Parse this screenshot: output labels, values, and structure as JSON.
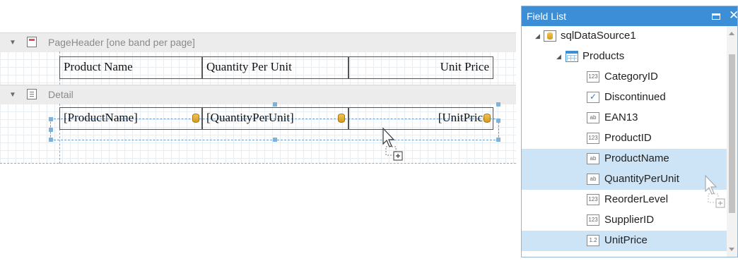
{
  "designer": {
    "page_header": {
      "title": "PageHeader [one band per page]"
    },
    "header_cells": {
      "product_name": "Product Name",
      "quantity_per_unit": "Quantity Per Unit",
      "unit_price": "Unit Price"
    },
    "detail": {
      "title": "Detail"
    },
    "detail_cells": {
      "product_name": "[ProductName]",
      "quantity_per_unit": "[QuantityPerUnit]",
      "unit_price": "[UnitPric"
    }
  },
  "field_list": {
    "title": "Field List",
    "datasource": "sqlDataSource1",
    "table": "Products",
    "fields": [
      {
        "name": "CategoryID",
        "icon": "123"
      },
      {
        "name": "Discontinued",
        "icon": "check"
      },
      {
        "name": "EAN13",
        "icon": "ab"
      },
      {
        "name": "ProductID",
        "icon": "123"
      },
      {
        "name": "ProductName",
        "icon": "ab",
        "selected": true
      },
      {
        "name": "QuantityPerUnit",
        "icon": "ab",
        "selected": true
      },
      {
        "name": "ReorderLevel",
        "icon": "123"
      },
      {
        "name": "SupplierID",
        "icon": "123"
      },
      {
        "name": "UnitPrice",
        "icon": "1.2",
        "selected": true
      }
    ]
  },
  "colors": {
    "accent": "#3c8fd6",
    "selection": "#cde4f7"
  }
}
